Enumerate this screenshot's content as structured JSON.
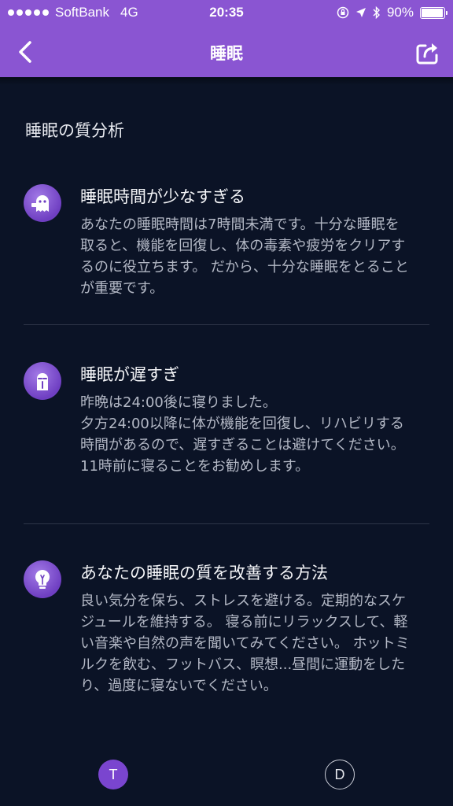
{
  "status_bar": {
    "carrier": "SoftBank",
    "network": "4G",
    "time": "20:35",
    "battery": "90%"
  },
  "nav": {
    "title": "睡眠",
    "back_icon": "chevron-left-icon",
    "share_icon": "share-icon"
  },
  "analysis": {
    "heading": "睡眠の質分析",
    "items": [
      {
        "icon": "ghost-icon",
        "title": "睡眠時間が少なすぎる",
        "body": "あなたの睡眠時間は7時間未満です。十分な睡眠を取ると、機能を回復し、体の毒素や疲労をクリアするのに役立ちます。 だから、十分な睡眠をとることが重要です。"
      },
      {
        "icon": "sleepy-face-icon",
        "title": "睡眠が遅すぎ",
        "body": "昨晩は24:00後に寝りました。\n夕方24:00以降に体が機能を回復し、リハビリする時間があるので、遅すぎることは避けてください。 11時前に寝ることをお勧めします。"
      },
      {
        "icon": "lightbulb-icon",
        "title": "あなたの睡眠の質を改善する方法",
        "body": "良い気分を保ち、ストレスを避ける。定期的なスケジュールを維持する。 寝る前にリラックスして、軽い音楽や自然の声を聞いてみてください。 ホットミルクを飲む、フットバス、瞑想...昼間に運動をしたり、過度に寝ないでください。"
      }
    ]
  },
  "footer": {
    "avatar_left": "T",
    "avatar_right": "D"
  },
  "colors": {
    "accent": "#8a55d2",
    "background": "#0b1326",
    "body_text": "#b3b8c5"
  }
}
